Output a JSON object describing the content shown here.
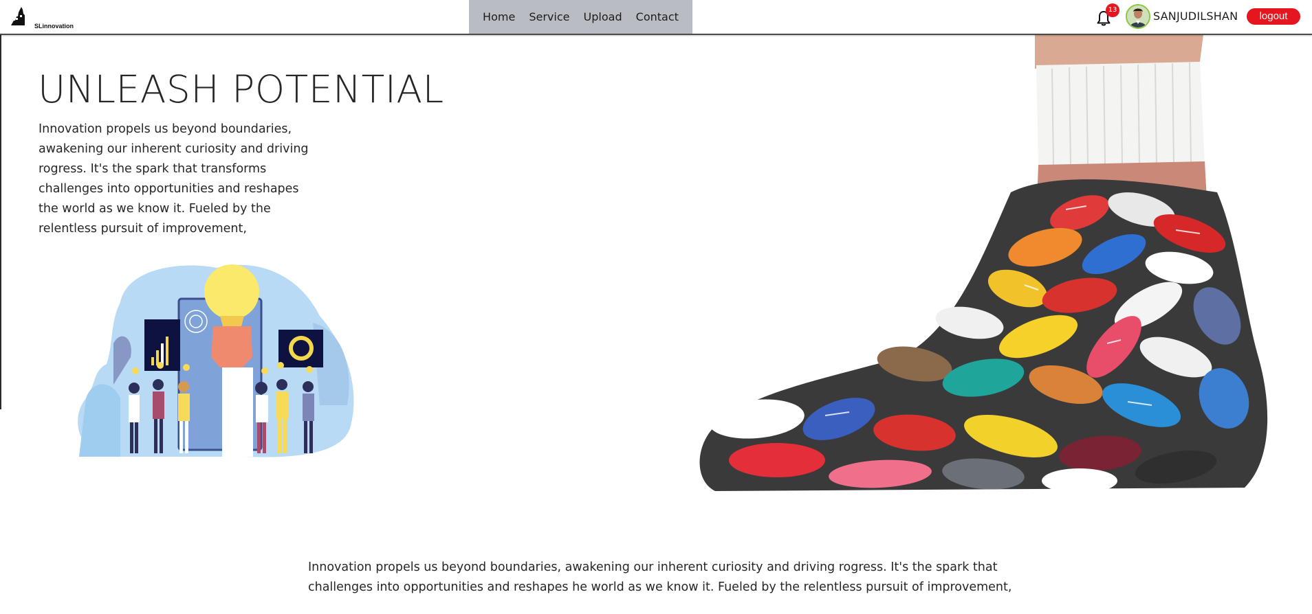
{
  "brand": {
    "logo_text": "SLinnovation"
  },
  "nav": {
    "items": [
      {
        "label": "Home"
      },
      {
        "label": "Service"
      },
      {
        "label": "Upload"
      },
      {
        "label": "Contact"
      }
    ]
  },
  "user": {
    "notification_count": "13",
    "username": "SANJUDILSHAN",
    "logout_label": "logout"
  },
  "hero": {
    "title": "UNLEASH POTENTIAL",
    "body": "Innovation propels us beyond boundaries, awakening our inherent curiosity and driving rogress. It's the spark that transforms challenges into opportunities and reshapes the world as we know it. Fueled by the relentless pursuit of improvement,"
  },
  "footer_text": "Innovation propels us beyond boundaries, awakening our inherent curiosity and driving rogress. It's the spark that challenges into opportunities and reshapes he world as we know it. Fueled by the relentless pursuit of improvement,",
  "colors": {
    "accent_red": "#e5161d",
    "nav_bg": "#b9bdc3",
    "avatar_ring": "#8ac640"
  },
  "icons": [
    "logo-icon",
    "bell-icon",
    "avatar-icon"
  ]
}
